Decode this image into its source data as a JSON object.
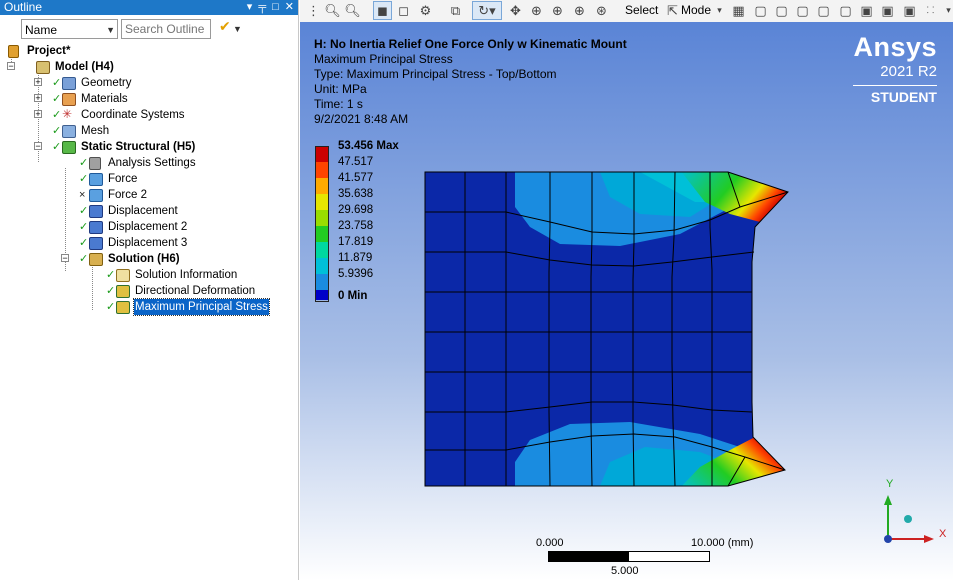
{
  "outline": {
    "title": "Outline",
    "title_buttons": [
      "▾",
      "ᵖ",
      "□",
      "✕"
    ],
    "filter_select": "Name",
    "search_placeholder": "Search Outline",
    "tree": [
      {
        "label": "Project*",
        "bold": true
      },
      {
        "label": "Model (H4)",
        "bold": true
      },
      {
        "label": "Geometry"
      },
      {
        "label": "Materials"
      },
      {
        "label": "Coordinate Systems"
      },
      {
        "label": "Mesh"
      },
      {
        "label": "Static Structural (H5)",
        "bold": true
      },
      {
        "label": "Analysis Settings"
      },
      {
        "label": "Force"
      },
      {
        "label": "Force 2"
      },
      {
        "label": "Displacement"
      },
      {
        "label": "Displacement 2"
      },
      {
        "label": "Displacement 3"
      },
      {
        "label": "Solution (H6)",
        "bold": true
      },
      {
        "label": "Solution Information"
      },
      {
        "label": "Directional Deformation"
      },
      {
        "label": "Maximum Principal Stress",
        "selected": true
      }
    ]
  },
  "toolbar": {
    "select_label": "Select",
    "mode_label": "Mode"
  },
  "viewport": {
    "header": {
      "title": "H: No Inertia Relief One Force Only w Kinematic Mount",
      "result_name": "Maximum Principal Stress",
      "type": "Type: Maximum Principal Stress - Top/Bottom",
      "unit": "Unit: MPa",
      "time": "Time: 1 s",
      "date": "9/2/2021 8:48 AM"
    },
    "logo": {
      "brand": "Ansys",
      "version": "2021 R2",
      "edition": "STUDENT"
    },
    "legend": [
      {
        "label": "53.456 Max",
        "color": "#cc0000",
        "bold": true
      },
      {
        "label": "47.517",
        "color": "#ff4400"
      },
      {
        "label": "41.577",
        "color": "#ffaa00"
      },
      {
        "label": "35.638",
        "color": "#e6e600"
      },
      {
        "label": "29.698",
        "color": "#99dd00"
      },
      {
        "label": "23.758",
        "color": "#22cc22"
      },
      {
        "label": "17.819",
        "color": "#00d8a0"
      },
      {
        "label": "11.879",
        "color": "#00c0d8"
      },
      {
        "label": "5.9396",
        "color": "#1a8ce0"
      },
      {
        "label": "0 Min",
        "color": "#0000c8",
        "bold": true
      }
    ],
    "scale": {
      "left": "0.000",
      "right": "10.000 (mm)",
      "mid": "5.000"
    },
    "triad": {
      "x": "X",
      "y": "Y"
    }
  },
  "colors": {
    "title_bar": "#1e78c8",
    "selection": "#0a64c8",
    "mesh_base": "#0b28a8"
  }
}
